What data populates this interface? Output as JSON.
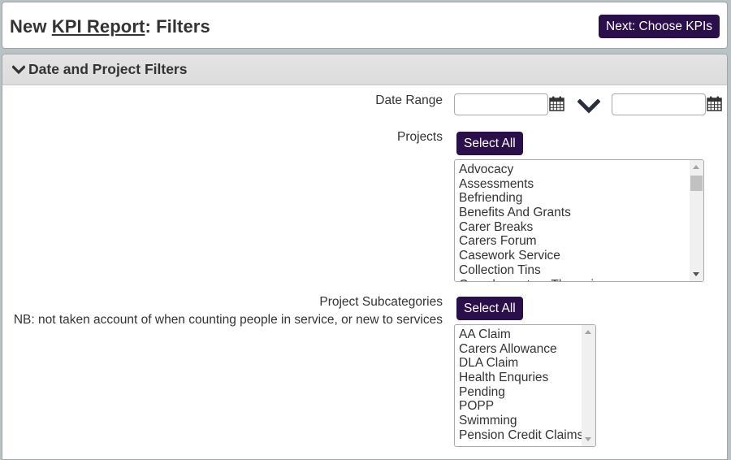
{
  "header": {
    "title_prefix": "New ",
    "title_link": "KPI Report",
    "title_suffix": ": Filters",
    "next_button": "Next: Choose KPIs"
  },
  "panel": {
    "heading": "Date and Project Filters",
    "date_range": {
      "label": "Date Range",
      "from_value": "",
      "to_value": ""
    },
    "projects": {
      "label": "Projects",
      "select_all": "Select All",
      "options": [
        "Advocacy",
        "Assessments",
        "Befriending",
        "Benefits And Grants",
        "Carer Breaks",
        "Carers Forum",
        "Casework Service",
        "Collection Tins",
        "Complementary Therapies"
      ]
    },
    "subcategories": {
      "label": "Project Subcategories",
      "note": "NB: not taken account of when counting people in service, or new to services",
      "select_all": "Select All",
      "options": [
        "AA Claim",
        "Carers Allowance",
        "DLA Claim",
        "Health Enquries",
        "Pending",
        "POPP",
        "Swimming",
        "Pension Credit Claims"
      ]
    }
  },
  "colors": {
    "primary_button": "#2b0f4a",
    "background": "#b9c2c4",
    "heading_bg": "#e0e0e0"
  }
}
